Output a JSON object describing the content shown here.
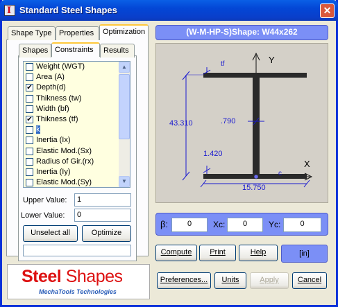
{
  "window": {
    "title": "Standard Steel Shapes",
    "icon_glyph": "I",
    "close_glyph": "✕"
  },
  "tabs": {
    "top": [
      "Shape Type",
      "Properties",
      "Optimization"
    ],
    "sub": [
      "Shapes",
      "Constraints",
      "Results"
    ]
  },
  "constraints": {
    "items": [
      {
        "label": "Weight (WGT)",
        "checked": false,
        "selected": false
      },
      {
        "label": "Area (A)",
        "checked": false,
        "selected": false
      },
      {
        "label": "Depth(d)",
        "checked": true,
        "selected": false
      },
      {
        "label": "Thikness (tw)",
        "checked": false,
        "selected": false
      },
      {
        "label": "Width (bf)",
        "checked": false,
        "selected": false
      },
      {
        "label": "Thikness (tf)",
        "checked": true,
        "selected": false
      },
      {
        "label": "k",
        "checked": false,
        "selected": true
      },
      {
        "label": "Inertia (Ix)",
        "checked": false,
        "selected": false
      },
      {
        "label": "Elastic Mod.(Sx)",
        "checked": false,
        "selected": false
      },
      {
        "label": "Radius of Gir.(rx)",
        "checked": false,
        "selected": false
      },
      {
        "label": "Inertia (Iy)",
        "checked": false,
        "selected": false
      },
      {
        "label": "Elastic Mod.(Sy)",
        "checked": false,
        "selected": false
      }
    ],
    "upper_label": "Upper Value:",
    "upper_value": "1",
    "lower_label": "Lower Value:",
    "lower_value": "0",
    "unselect_label": "Unselect all",
    "optimize_label": "Optimize"
  },
  "logo": {
    "main_bold": "Steel",
    "main_light": " Shapes",
    "sub": "MechaTools Technologies"
  },
  "shape": {
    "title": "(W-M-HP-S)Shape: W44x262",
    "dims": {
      "depth": "43.310",
      "web": ".790",
      "flange_thk": "1.420",
      "width": "15.750",
      "tf_label": "tf",
      "c_label": "c",
      "x_axis": "X",
      "y_axis": "Y"
    }
  },
  "params": {
    "beta_label": "β:",
    "beta_value": "0",
    "xc_label": "Xc:",
    "xc_value": "0",
    "yc_label": "Yc:",
    "yc_value": "0"
  },
  "actions": {
    "compute": "Compute",
    "print": "Print",
    "help": "Help",
    "units_display": "[in]",
    "preferences": "Preferences...",
    "units": "Units",
    "apply": "Apply",
    "cancel": "Cancel"
  },
  "colors": {
    "accent_blue": "#7b8ff6",
    "list_bg": "#ffffe0",
    "dimension_blue": "#1a1ad0",
    "section_dark": "#2a2a2a"
  }
}
